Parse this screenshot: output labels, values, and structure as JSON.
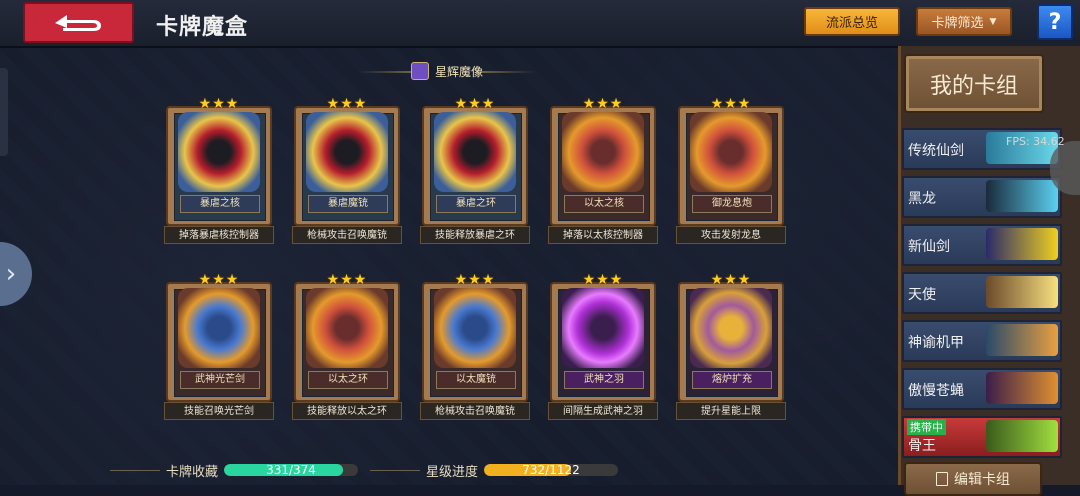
{
  "header": {
    "title": "卡牌魔盒",
    "overview_label": "流派总览",
    "filter_label": "卡牌筛选",
    "help_label": "?"
  },
  "section": {
    "title": "星辉魔像"
  },
  "cards": [
    {
      "stars": "★★★",
      "name": "暴虐之核",
      "desc": "掉落暴虐核控制器",
      "theme": "blue",
      "art": "red"
    },
    {
      "stars": "★★★",
      "name": "暴虐魔铳",
      "desc": "枪械攻击召唤魔铳",
      "theme": "blue",
      "art": "red"
    },
    {
      "stars": "★★★",
      "name": "暴虐之环",
      "desc": "技能释放暴虐之环",
      "theme": "blue",
      "art": "red"
    },
    {
      "stars": "★★★",
      "name": "以太之核",
      "desc": "掉落以太核控制器",
      "theme": "orange",
      "art": "orange"
    },
    {
      "stars": "★★★",
      "name": "御龙息炮",
      "desc": "攻击发射龙息",
      "theme": "orange",
      "art": "orange"
    },
    {
      "stars": "★★★",
      "name": "武神光芒剑",
      "desc": "技能召唤光芒剑",
      "theme": "orange",
      "art": "blue"
    },
    {
      "stars": "★★★",
      "name": "以太之环",
      "desc": "技能释放以太之环",
      "theme": "orange",
      "art": "orange"
    },
    {
      "stars": "★★★",
      "name": "以太魔铳",
      "desc": "枪械攻击召唤魔铳",
      "theme": "orange",
      "art": "blue"
    },
    {
      "stars": "★★★",
      "name": "武神之羽",
      "desc": "间隔生成武神之羽",
      "theme": "purple",
      "art": "purple"
    },
    {
      "stars": "★★★",
      "name": "熔炉扩充",
      "desc": "提升星能上限",
      "theme": "purple",
      "art": "gold"
    }
  ],
  "deck_panel": {
    "title": "我的卡组",
    "fps": "FPS: 34.62",
    "decks": [
      {
        "label": "传统仙剑"
      },
      {
        "label": "黑龙"
      },
      {
        "label": "新仙剑"
      },
      {
        "label": "天使"
      },
      {
        "label": "神谕机甲"
      },
      {
        "label": "傲慢苍蝇"
      },
      {
        "label": "骨王",
        "tag": "携带中"
      }
    ],
    "edit_label": "编辑卡组"
  },
  "stats": {
    "collection_label": "卡牌收藏",
    "collection_value": "331/374",
    "collection_fraction": 0.885,
    "star_label": "星级进度",
    "star_value": "732/1122",
    "star_fraction": 0.652
  },
  "colors": {
    "accent_orange": "#f7b63a",
    "back_red": "#c8283a",
    "help_blue": "#3d8af0",
    "collection_bar": "#2ad6a0",
    "star_bar": "#f0b020"
  }
}
